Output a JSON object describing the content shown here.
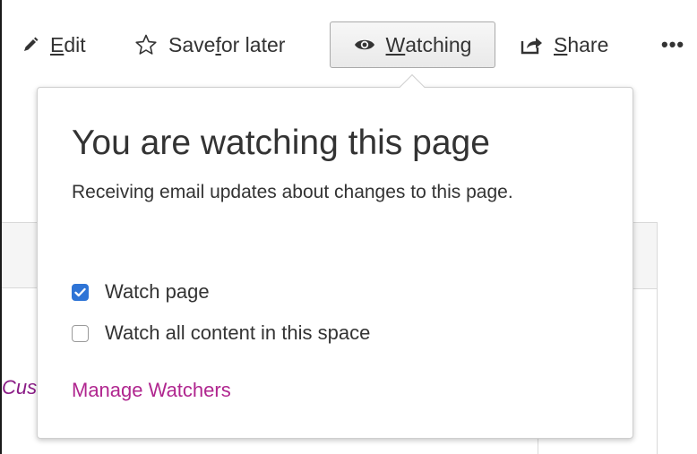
{
  "toolbar": {
    "edit": {
      "label_first": "E",
      "label_rest": "dit",
      "icon": "pencil-icon"
    },
    "save": {
      "label_before": "Save ",
      "label_underline": "f",
      "label_after": "or later",
      "icon": "star-outline-icon"
    },
    "watch": {
      "label_first": "W",
      "label_rest": "atching",
      "icon": "eye-icon"
    },
    "share": {
      "label_first": "S",
      "label_rest": "hare",
      "icon": "share-arrow-icon"
    },
    "more": {
      "label": "•••",
      "icon": "more-dots-icon"
    }
  },
  "background": {
    "partial_text": "Cus"
  },
  "popup": {
    "title": "You are watching this page",
    "description": "Receiving email updates about changes to this page.",
    "options": [
      {
        "label": "Watch page",
        "checked": true
      },
      {
        "label": "Watch all content in this space",
        "checked": false
      }
    ],
    "manage_link": "Manage Watchers"
  },
  "colors": {
    "link": "#b0268f",
    "checkbox_checked": "#2e74d6",
    "text": "#333333"
  }
}
